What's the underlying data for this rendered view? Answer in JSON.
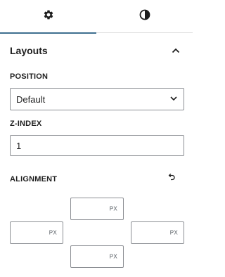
{
  "tabs": [
    {
      "icon": "gear-icon"
    },
    {
      "icon": "contrast-icon"
    }
  ],
  "panel": {
    "title": "Layouts"
  },
  "position": {
    "label": "POSITION",
    "value": "Default"
  },
  "zindex": {
    "label": "Z-INDEX",
    "value": "1"
  },
  "alignment": {
    "label": "ALIGNMENT",
    "top_unit": "PX",
    "left_unit": "PX",
    "right_unit": "PX",
    "bottom_unit": "PX"
  },
  "colors": {
    "accent": "#3f6f8f",
    "border": "#8c8f94",
    "text": "#1e1e1e"
  }
}
